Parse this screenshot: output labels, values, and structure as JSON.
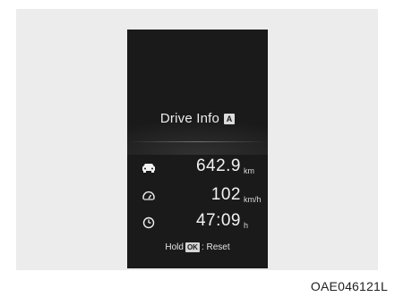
{
  "display": {
    "title": "Drive Info",
    "title_badge": "A",
    "rows": [
      {
        "icon": "car-icon",
        "value": "642.9",
        "unit": "km"
      },
      {
        "icon": "speedometer-icon",
        "value": "102",
        "unit": "km/h"
      },
      {
        "icon": "clock-icon",
        "value": "47:09",
        "unit": "h"
      }
    ],
    "hold_prefix": "Hold",
    "ok_label": "OK",
    "hold_suffix": ": Reset"
  },
  "caption": "OAE046121L",
  "colors": {
    "screen_bg": "#1a1a1a",
    "frame_bg": "#ececec",
    "text": "#f2f2f2"
  }
}
